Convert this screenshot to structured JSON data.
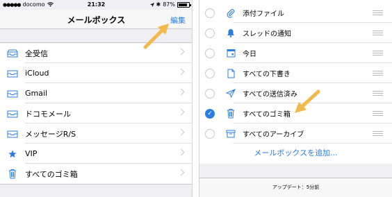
{
  "status_bar": {
    "carrier": "docomo",
    "time": "21:32",
    "battery": "87%",
    "battery_level": 0.87
  },
  "left": {
    "title": "メールボックス",
    "edit_label": "編集",
    "items": [
      {
        "label": "全受信",
        "icon": "inbox-stack-icon"
      },
      {
        "label": "iCloud",
        "icon": "inbox-icon"
      },
      {
        "label": "Gmail",
        "icon": "inbox-icon"
      },
      {
        "label": "ドコモメール",
        "icon": "inbox-icon"
      },
      {
        "label": "メッセージR/S",
        "icon": "inbox-icon"
      },
      {
        "label": "VIP",
        "icon": "star-icon"
      },
      {
        "label": "すべてのゴミ箱",
        "icon": "trash-icon"
      }
    ]
  },
  "right": {
    "items": [
      {
        "label": "添付ファイル",
        "icon": "paperclip-icon",
        "checked": false
      },
      {
        "label": "スレッドの通知",
        "icon": "bell-icon",
        "checked": false
      },
      {
        "label": "今日",
        "icon": "calendar-icon",
        "checked": false
      },
      {
        "label": "すべての下書き",
        "icon": "document-icon",
        "checked": false
      },
      {
        "label": "すべての送信済み",
        "icon": "paper-plane-icon",
        "checked": false
      },
      {
        "label": "すべてのゴミ箱",
        "icon": "trash-icon",
        "checked": true
      },
      {
        "label": "すべてのアーカイブ",
        "icon": "archive-box-icon",
        "checked": false
      }
    ],
    "add_label": "メールボックスを追加...",
    "updated": "アップデート：5分前"
  },
  "colors": {
    "accent": "#2a7de1",
    "arrow": "#f2b84b"
  }
}
